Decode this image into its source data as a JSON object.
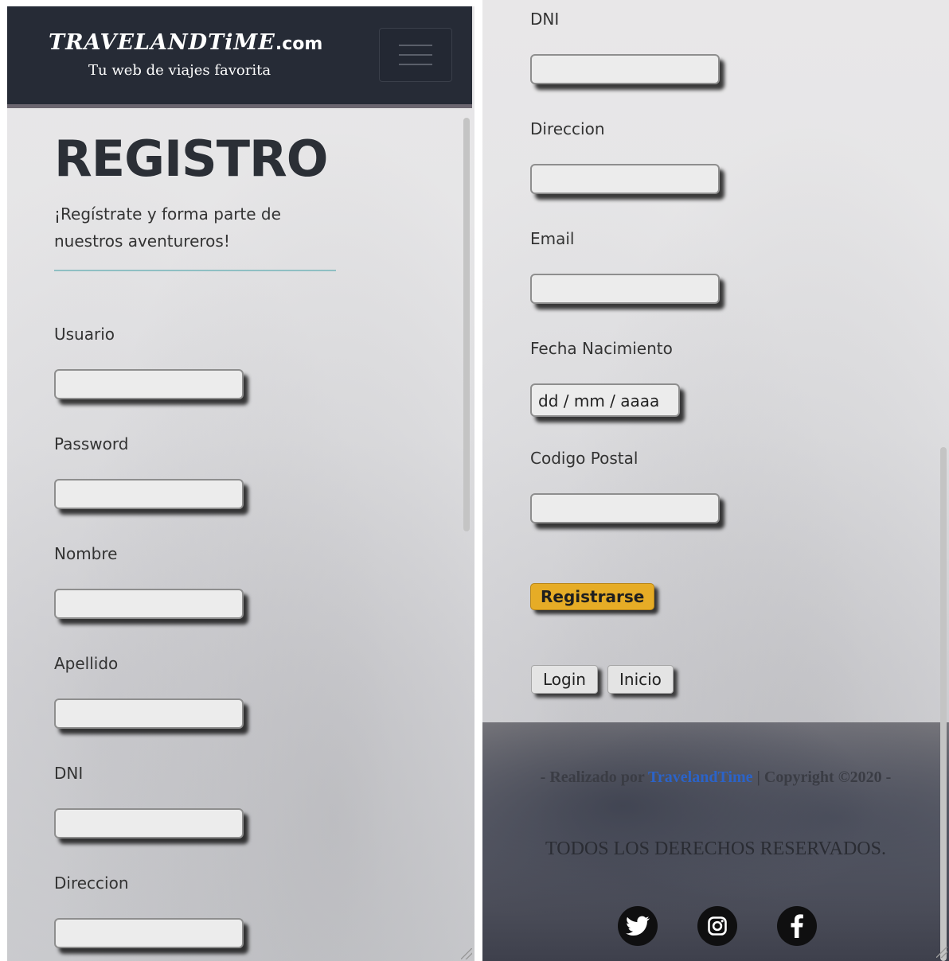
{
  "header": {
    "logo_main": "TRAVELANDTiME",
    "logo_suffix": ".com",
    "tagline": "Tu web de viajes favorita",
    "menu_icon": "hamburger-menu-icon"
  },
  "page": {
    "title": "REGISTRO",
    "subtitle": "¡Regístrate y forma parte de nuestros aventureros!"
  },
  "form": {
    "usuario_label": "Usuario",
    "password_label": "Password",
    "nombre_label": "Nombre",
    "apellido_label": "Apellido",
    "dni_label": "DNI",
    "direccion_label": "Direccion",
    "email_label": "Email",
    "fecha_label": "Fecha Nacimiento",
    "fecha_placeholder": "dd / mm / aaaa",
    "codigo_label": "Codigo Postal",
    "submit_label": "Registrarse"
  },
  "nav": {
    "login_label": "Login",
    "inicio_label": "Inicio"
  },
  "footer": {
    "prefix": "- Realizado por ",
    "brand": "TravelandTime",
    "suffix": " | Copyright ©2020 -",
    "rights": "TODOS LOS DERECHOS RESERVADOS.",
    "social": [
      "twitter-icon",
      "instagram-icon",
      "facebook-icon"
    ]
  },
  "colors": {
    "header_bg": "#262b36",
    "accent_button": "#e6ac26",
    "divider": "#8fbfc3",
    "brand_link": "#2b63c8"
  }
}
